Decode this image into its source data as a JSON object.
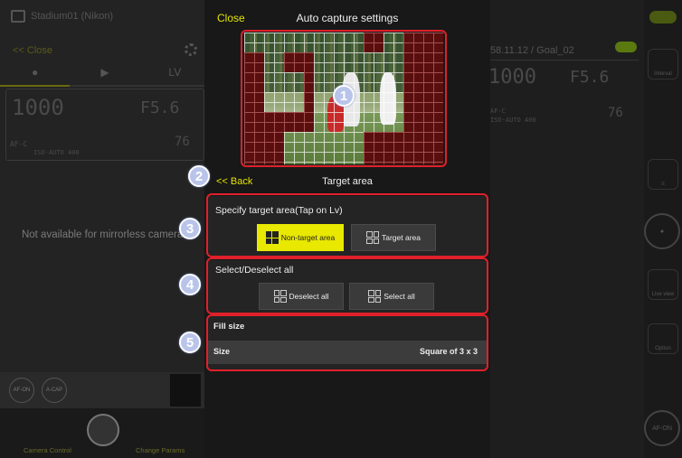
{
  "left_panel": {
    "camera_name": "Stadium01 (Nikon)",
    "close_link": "<< Close",
    "tabs": [
      "",
      "",
      "LV"
    ],
    "shutter": "1000",
    "aperture": "F5.6",
    "af_mode": "AF-C",
    "iso": "ISO-AUTO 400",
    "remaining": "76",
    "message": "Not available for mirrorless cameras",
    "af_on": "AF-ON",
    "a_cap": "A-CAP",
    "nav_camera_control": "Camera Control",
    "nav_change_params": "Change Params"
  },
  "right_panel": {
    "info": "58.11.12 / Goal_02",
    "shutter": "1000",
    "aperture": "F5.6",
    "af_mode": "AF-C",
    "iso": "ISO-AUTO 400",
    "remaining": "76",
    "side_interval": "Interval",
    "side_lv": "LV",
    "side_lv_sub": "Live view",
    "side_option": "Option",
    "side_afon": "AF-ON"
  },
  "dialog": {
    "close_label": "Close",
    "title": "Auto capture settings",
    "back_label": "<< Back",
    "target_area_label": "Target area",
    "specify_section": {
      "title": "Specify target area(Tap on Lv)",
      "non_target_button": "Non-target area",
      "target_button": "Target area",
      "selected": "Non-target area"
    },
    "select_section": {
      "title": "Select/Deselect all",
      "deselect_button": "Deselect all",
      "select_button": "Select all"
    },
    "fill_size": {
      "title": "Fill size",
      "label": "Size",
      "value": "Square of 3 x 3"
    }
  },
  "callouts": [
    "1",
    "2",
    "3",
    "4",
    "5"
  ],
  "colors": {
    "accent_yellow": "#e8e800",
    "callout_red": "#e0202a",
    "badge_blue": "#b9c4ea",
    "mask_red": "#5a0e0e"
  }
}
